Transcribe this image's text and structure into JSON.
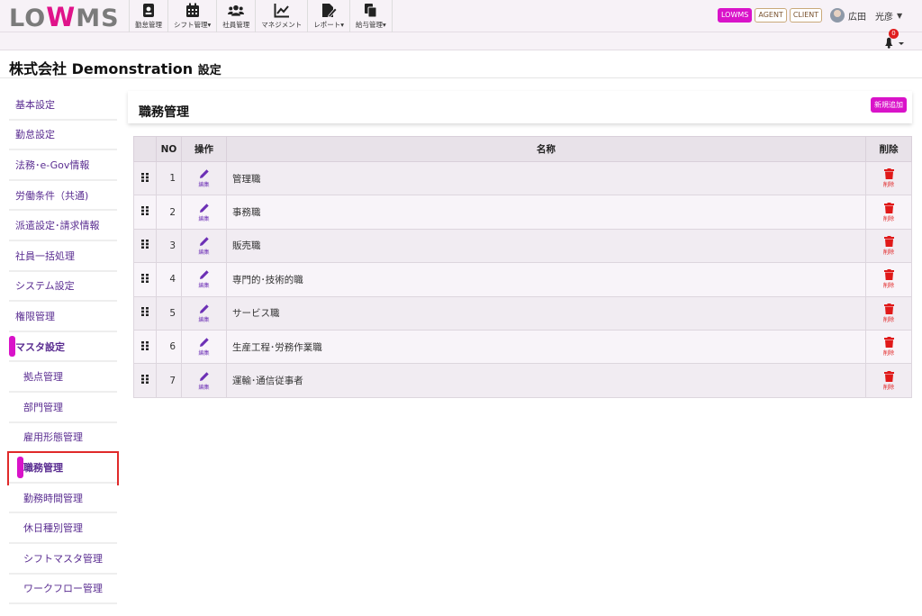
{
  "header": {
    "logo": {
      "pre": "LO",
      "mid": "W",
      "post": "MS"
    },
    "nav": [
      {
        "label": "勤怠管理",
        "icon": "id-badge-icon"
      },
      {
        "label": "シフト管理▾",
        "icon": "calendar-icon"
      },
      {
        "label": "社員管理",
        "icon": "users-icon"
      },
      {
        "label": "マネジメント",
        "icon": "chart-line-icon"
      },
      {
        "label": "レポート▾",
        "icon": "file-edit-icon"
      },
      {
        "label": "給与管理▾",
        "icon": "copy-icon"
      }
    ],
    "badges": [
      "LOWMS",
      "AGENT",
      "CLIENT"
    ],
    "user_name": "広田　光彦",
    "notification_count": "0"
  },
  "page": {
    "title": "株式会社 Demonstration",
    "title_suffix": "設定"
  },
  "sidebar": {
    "items": [
      {
        "label": "基本設定"
      },
      {
        "label": "勤怠設定"
      },
      {
        "label": "法務･e-Gov情報"
      },
      {
        "label": "労働条件（共通)"
      },
      {
        "label": "派遣設定･請求情報"
      },
      {
        "label": "社員一括処理"
      },
      {
        "label": "システム設定"
      },
      {
        "label": "権限管理"
      },
      {
        "label": "マスタ設定"
      }
    ],
    "subitems": [
      {
        "label": "拠点管理"
      },
      {
        "label": "部門管理"
      },
      {
        "label": "雇用形態管理"
      },
      {
        "label": "職務管理"
      },
      {
        "label": "勤務時間管理"
      },
      {
        "label": "休日種別管理"
      },
      {
        "label": "シフトマスタ管理"
      },
      {
        "label": "ワークフロー管理"
      }
    ]
  },
  "main": {
    "title": "職務管理",
    "new_button": "新規追加",
    "columns": {
      "no": "NO",
      "op": "操作",
      "name": "名称",
      "del": "削除"
    },
    "edit_label": "編集",
    "delete_label": "削除",
    "rows": [
      {
        "no": "1",
        "name": "管理職"
      },
      {
        "no": "2",
        "name": "事務職"
      },
      {
        "no": "3",
        "name": "販売職"
      },
      {
        "no": "4",
        "name": "専門的･技術的職"
      },
      {
        "no": "5",
        "name": "サービス職"
      },
      {
        "no": "6",
        "name": "生産工程･労務作業職"
      },
      {
        "no": "7",
        "name": "運輸･通信従事者"
      }
    ]
  },
  "colors": {
    "accent": "#d913c9",
    "link": "#5a2d91",
    "danger": "#e01919"
  }
}
